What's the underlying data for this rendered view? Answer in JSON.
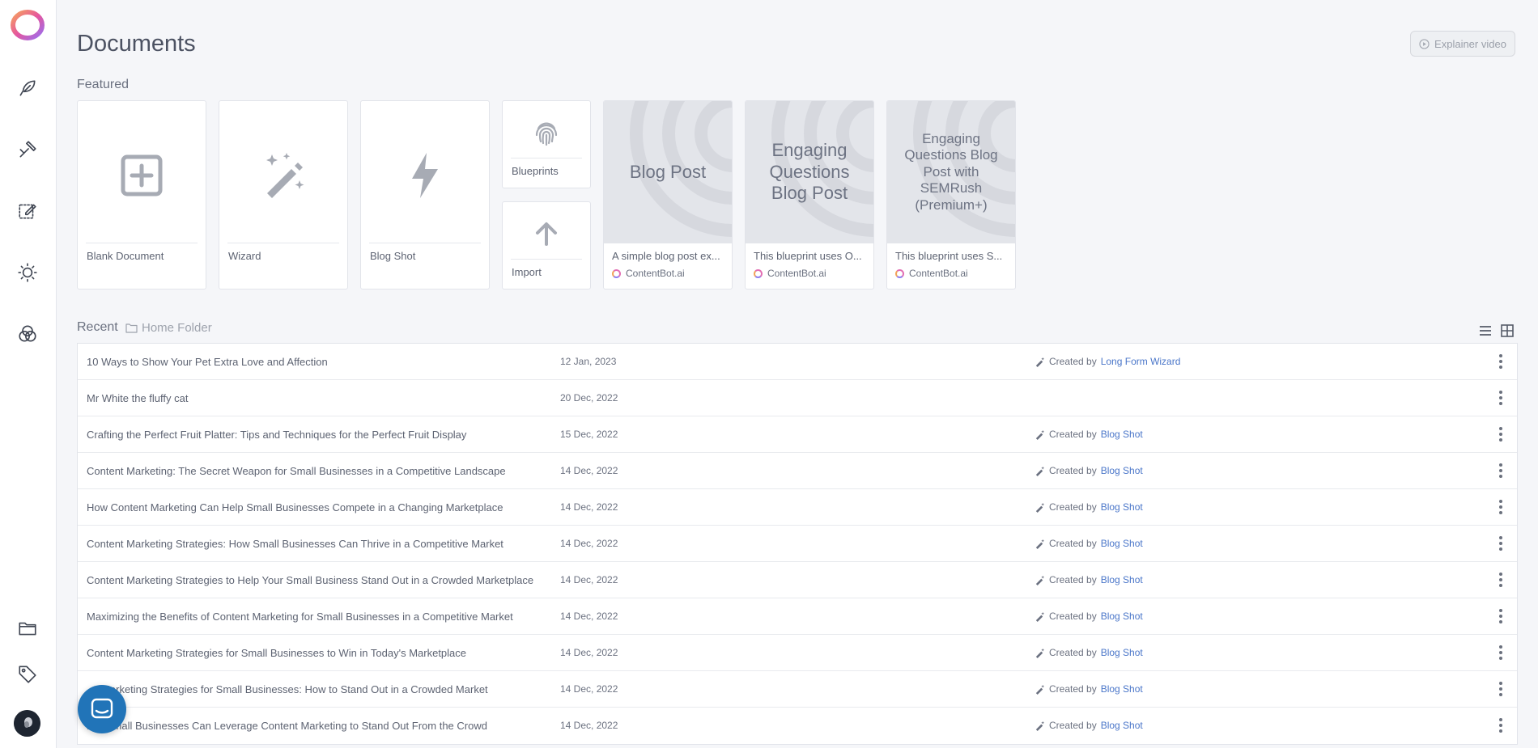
{
  "page": {
    "title": "Documents",
    "explainer_label": "Explainer video"
  },
  "sidebar": {
    "items": [
      {
        "name": "feather-icon"
      },
      {
        "name": "tools-icon"
      },
      {
        "name": "edit-icon"
      },
      {
        "name": "lightbulb-icon"
      },
      {
        "name": "circles-icon"
      },
      {
        "name": "folder-icon"
      },
      {
        "name": "tag-icon"
      }
    ]
  },
  "featured": {
    "label": "Featured",
    "tiles": {
      "blank": "Blank Document",
      "wizard": "Wizard",
      "blogshot": "Blog Shot",
      "blueprints": "Blueprints",
      "import": "Import"
    },
    "blueprints": [
      {
        "title": "Blog Post",
        "description": "A simple blog post ex...",
        "author": "ContentBot.ai"
      },
      {
        "title": "Engaging Questions Blog Post",
        "description": "This blueprint uses O...",
        "author": "ContentBot.ai"
      },
      {
        "title": "Engaging Questions Blog Post with SEMRush (Premium+)",
        "description": "This blueprint uses S...",
        "author": "ContentBot.ai"
      }
    ]
  },
  "recent": {
    "label": "Recent",
    "folder": "Home Folder",
    "created_prefix": "Created by",
    "rows": [
      {
        "title": "10 Ways to Show Your Pet Extra Love and Affection",
        "date": "12 Jan, 2023",
        "creator": "Long Form Wizard"
      },
      {
        "title": "Mr White the fluffy cat",
        "date": "20 Dec, 2022",
        "creator": ""
      },
      {
        "title": "Crafting the Perfect Fruit Platter: Tips and Techniques for the Perfect Fruit Display",
        "date": "15 Dec, 2022",
        "creator": "Blog Shot"
      },
      {
        "title": "Content Marketing: The Secret Weapon for Small Businesses in a Competitive Landscape",
        "date": "14 Dec, 2022",
        "creator": "Blog Shot"
      },
      {
        "title": "How Content Marketing Can Help Small Businesses Compete in a Changing Marketplace",
        "date": "14 Dec, 2022",
        "creator": "Blog Shot"
      },
      {
        "title": "Content Marketing Strategies: How Small Businesses Can Thrive in a Competitive Market",
        "date": "14 Dec, 2022",
        "creator": "Blog Shot"
      },
      {
        "title": "Content Marketing Strategies to Help Your Small Business Stand Out in a Crowded Marketplace",
        "date": "14 Dec, 2022",
        "creator": "Blog Shot"
      },
      {
        "title": "Maximizing the Benefits of Content Marketing for Small Businesses in a Competitive Market",
        "date": "14 Dec, 2022",
        "creator": "Blog Shot"
      },
      {
        "title": "Content Marketing Strategies for Small Businesses to Win in Today's Marketplace",
        "date": "14 Dec, 2022",
        "creator": "Blog Shot"
      },
      {
        "title": "...t Marketing Strategies for Small Businesses: How to Stand Out in a Crowded Market",
        "date": "14 Dec, 2022",
        "creator": "Blog Shot"
      },
      {
        "title": "H... Small Businesses Can Leverage Content Marketing to Stand Out From the Crowd",
        "date": "14 Dec, 2022",
        "creator": "Blog Shot"
      }
    ]
  }
}
